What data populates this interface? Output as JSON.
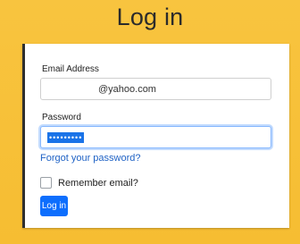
{
  "page": {
    "title": "Log in"
  },
  "form": {
    "email_label": "Email Address",
    "email_value": "@yahoo.com",
    "password_label": "Password",
    "password_value_masked": "•••••••••",
    "forgot_link": "Forgot your password?",
    "remember_label": "Remember email?",
    "login_button": "Log in"
  },
  "colors": {
    "background": "#f7c23a",
    "primary": "#0d6efd",
    "link": "#1f62c5",
    "card": "#ffffff"
  }
}
